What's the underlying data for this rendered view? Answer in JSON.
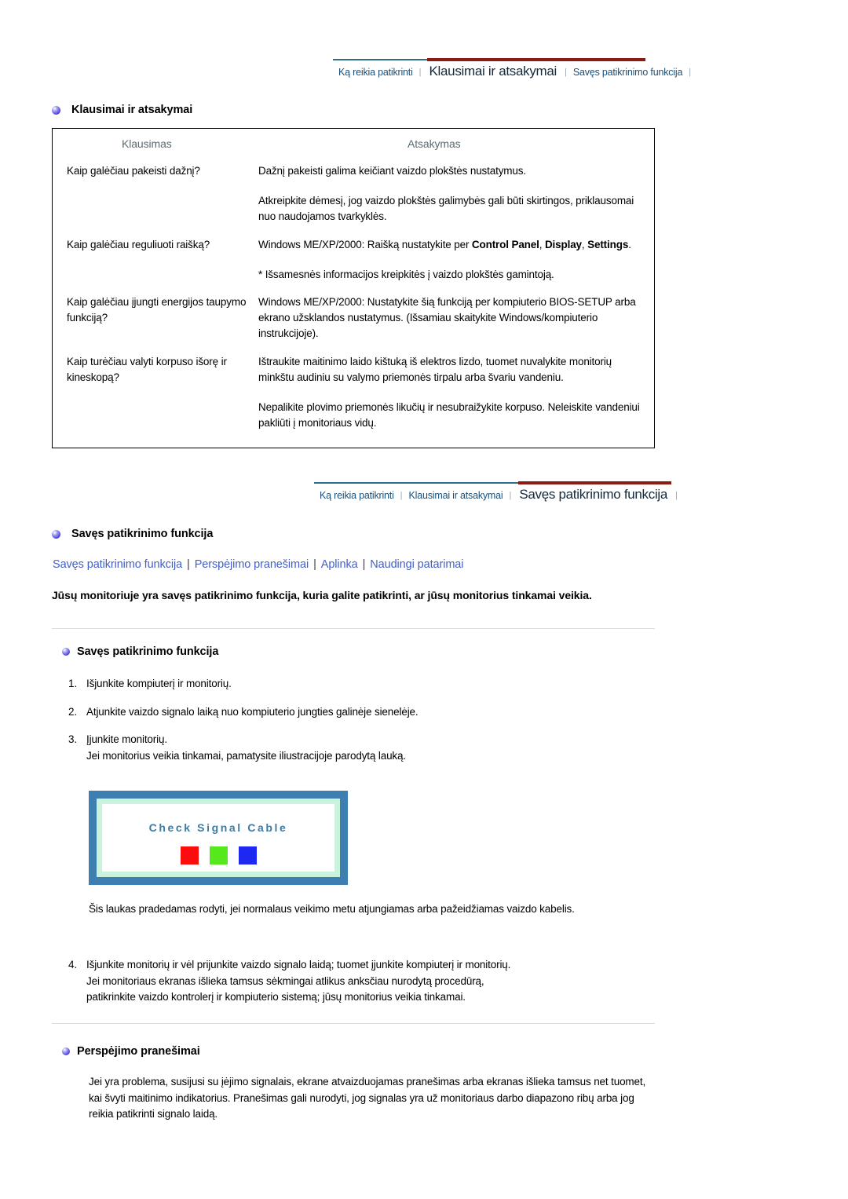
{
  "nav_top": {
    "items": [
      {
        "label": "Ką reikia patikrinti",
        "active": false
      },
      {
        "label": "Klausimai ir atsakymai",
        "active": true
      },
      {
        "label": "Savęs patikrinimo funkcija",
        "active": false
      }
    ],
    "separator": "|",
    "accent_left": "#2e6d86",
    "accent_right": "#8b1a13"
  },
  "faq_section": {
    "heading": "Klausimai ir atsakymai",
    "columns": {
      "question": "Klausimas",
      "answer": "Atsakymas"
    },
    "rows": [
      {
        "question": [
          "Kaip galėčiau pakeisti dažnį?"
        ],
        "answer": [
          "Dažnį pakeisti galima keičiant vaizdo plokštės nustatymus.",
          "Atkreipkite dėmesį, jog vaizdo plokštės galimybės gali būti skirtingos, priklausomai nuo naudojamos tvarkyklės."
        ]
      },
      {
        "question": [
          "Kaip galėčiau reguliuoti raišką?"
        ],
        "answer_html": "Windows ME/XP/2000: Raišką nustatykite per <b>Control Panel</b>, <b>Display</b>, <b>Settings</b>.",
        "answer": [
          "* Išsamesnės informacijos kreipkitės į vaizdo plokštės gamintoją."
        ]
      },
      {
        "question": [
          "Kaip galėčiau įjungti energijos taupymo funkciją?"
        ],
        "answer": [
          "Windows ME/XP/2000: Nustatykite šią funkciją per kompiuterio BIOS-SETUP arba ekrano užsklandos nustatymus. (Išsamiau skaitykite Windows/kompiuterio instrukcijoje)."
        ]
      },
      {
        "question": [
          "Kaip turėčiau valyti korpuso išorę ir kineskopą?"
        ],
        "answer": [
          "Ištraukite maitinimo laido kištuką iš elektros lizdo, tuomet nuvalykite monitorių minkštu audiniu su valymo priemonės tirpalu arba švariu vandeniu.",
          "Nepalikite plovimo priemonės likučių ir nesubraižykite korpuso. Neleiskite vandeniui pakliūti į monitoriaus vidų."
        ]
      }
    ]
  },
  "nav_bottom": {
    "items": [
      {
        "label": "Ką reikia patikrinti",
        "active": false
      },
      {
        "label": "Klausimai ir atsakymai",
        "active": false
      },
      {
        "label": "Savęs patikrinimo funkcija",
        "active": true
      }
    ],
    "separator": "|"
  },
  "selftest_section": {
    "heading": "Savęs patikrinimo funkcija",
    "sublinks": [
      "Savęs patikrinimo funkcija",
      "Perspėjimo pranešimai",
      "Aplinka",
      "Naudingi patarimai"
    ],
    "sublink_sep": "|",
    "sublink_color": "#4360c8",
    "intro": "Jūsų monitoriuje yra savęs patikrinimo funkcija, kuria galite patikrinti, ar jūsų monitorius tinkamai veikia.",
    "subheading": "Savęs patikrinimo funkcija",
    "steps": [
      {
        "num": "1.",
        "lines": [
          "Išjunkite kompiuterį ir monitorių."
        ]
      },
      {
        "num": "2.",
        "lines": [
          "Atjunkite vaizdo signalo laiką nuo kompiuterio jungties galinėje sienelėje."
        ]
      },
      {
        "num": "3.",
        "lines": [
          "Įjunkite monitorių.",
          "Jei monitorius veikia tinkamai, pamatysite iliustracijoje parodytą lauką."
        ]
      }
    ],
    "illustration": {
      "title": "Check Signal Cable",
      "outer_color": "#3c7fb0",
      "inner_border_color": "#c9f3dd",
      "screen_color": "#ffffff",
      "title_color": "#3d7ba2",
      "swatches": [
        "#fc0d0d",
        "#55e81c",
        "#1d28f0"
      ]
    },
    "caption": "Šis laukas pradedamas rodyti, jei normalaus veikimo metu atjungiamas arba pažeidžiamas vaizdo kabelis.",
    "step4": {
      "num": "4.",
      "lines": [
        "Išjunkite monitorių ir vėl prijunkite vaizdo signalo laidą; tuomet įjunkite kompiuterį ir monitorių.",
        "Jei monitoriaus ekranas išlieka tamsus sėkmingai atlikus anksčiau nurodytą procedūrą,",
        "patikrinkite vaizdo kontrolerį ir kompiuterio sistemą; jūsų monitorius veikia tinkamai."
      ]
    }
  },
  "warning_section": {
    "heading": "Perspėjimo pranešimai",
    "body": "Jei yra problema, susijusi su įėjimo signalais, ekrane atvaizduojamas pranešimas arba ekranas išlieka tamsus net tuomet, kai švyti maitinimo indikatorius. Pranešimas gali nurodyti, jog signalas yra už monitoriaus darbo diapazono ribų arba jog reikia patikrinti signalo laidą."
  }
}
